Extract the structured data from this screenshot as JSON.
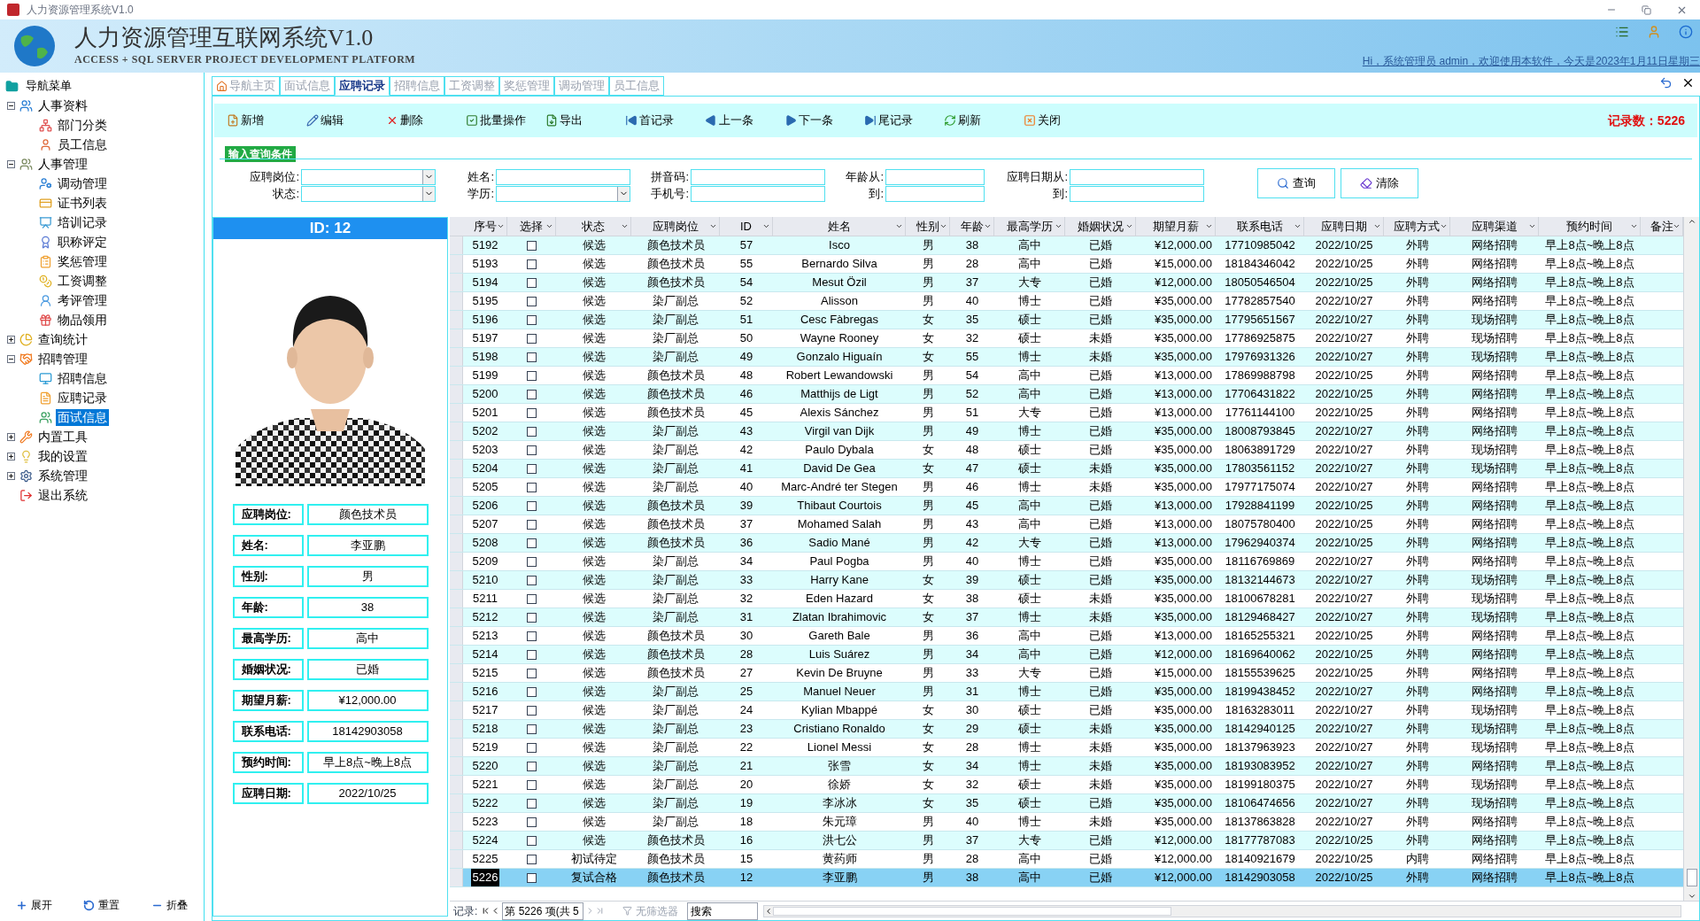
{
  "window": {
    "title": "人力资源管理系统V1.0"
  },
  "header": {
    "title": "人力资源管理互联网系统V1.0",
    "subtitle": "ACCESS + SQL SERVER PROJECT DEVELOPMENT PLATFORM",
    "welcome": "Hi，系统管理员 admin，欢迎使用本软件，今天是2023年1月11日星期三"
  },
  "sidebar": {
    "title": "导航菜单",
    "items": [
      {
        "label": "人事资料",
        "expanded": true,
        "selected": false,
        "children": [
          {
            "label": "部门分类",
            "selected": false
          },
          {
            "label": "员工信息",
            "selected": false
          }
        ]
      },
      {
        "label": "人事管理",
        "expanded": true,
        "selected": false,
        "children": [
          {
            "label": "调动管理",
            "selected": false
          },
          {
            "label": "证书列表",
            "selected": false
          },
          {
            "label": "培训记录",
            "selected": false
          },
          {
            "label": "职称评定",
            "selected": false
          },
          {
            "label": "奖惩管理",
            "selected": false
          },
          {
            "label": "工资调整",
            "selected": false
          },
          {
            "label": "考评管理",
            "selected": false
          },
          {
            "label": "物品领用",
            "selected": false
          }
        ]
      },
      {
        "label": "查询统计",
        "expanded": false,
        "selected": false
      },
      {
        "label": "招聘管理",
        "expanded": true,
        "selected": false,
        "children": [
          {
            "label": "招聘信息",
            "selected": false
          },
          {
            "label": "应聘记录",
            "selected": false
          },
          {
            "label": "面试信息",
            "selected": true
          }
        ]
      },
      {
        "label": "内置工具",
        "expanded": false,
        "selected": false
      },
      {
        "label": "我的设置",
        "expanded": false,
        "selected": false
      },
      {
        "label": "系统管理",
        "expanded": false,
        "selected": false
      },
      {
        "label": "退出系统",
        "selected": false
      }
    ],
    "footer": [
      "展开",
      "重置",
      "折叠"
    ]
  },
  "tabs": [
    {
      "label": "导航主页",
      "selected": false
    },
    {
      "label": "面试信息",
      "selected": false
    },
    {
      "label": "应聘记录",
      "selected": true
    },
    {
      "label": "招聘信息",
      "selected": false
    },
    {
      "label": "工资调整",
      "selected": false
    },
    {
      "label": "奖惩管理",
      "selected": false
    },
    {
      "label": "调动管理",
      "selected": false
    },
    {
      "label": "员工信息",
      "selected": false
    }
  ],
  "toolbar": {
    "buttons": [
      "新增",
      "编辑",
      "删除",
      "批量操作",
      "导出",
      "首记录",
      "上一条",
      "下一条",
      "尾记录",
      "刷新",
      "关闭"
    ],
    "record_count": "记录数：5226"
  },
  "query": {
    "title": "输入查询条件",
    "groups": [
      [
        {
          "label": "应聘岗位:",
          "kind": "select"
        },
        {
          "label": "状态:",
          "kind": "select"
        }
      ],
      [
        {
          "label": "姓名:",
          "kind": "text"
        },
        {
          "label": "学历:",
          "kind": "select"
        }
      ],
      [
        {
          "label": "拼音码:",
          "kind": "text"
        },
        {
          "label": "手机号:",
          "kind": "text"
        }
      ],
      [
        {
          "label": "年龄从:",
          "kind": "text"
        },
        {
          "label": "到:",
          "kind": "text"
        }
      ],
      [
        {
          "label": "应聘日期从:",
          "kind": "text"
        },
        {
          "label": "到:",
          "kind": "text"
        }
      ]
    ],
    "buttons": [
      "查询",
      "清除"
    ]
  },
  "profile": {
    "heading": "ID: 12",
    "fields": [
      {
        "label": "应聘岗位:",
        "value": "颜色技术员"
      },
      {
        "label": "姓名:",
        "value": "李亚鹏"
      },
      {
        "label": "性别:",
        "value": "男"
      },
      {
        "label": "年龄:",
        "value": "38"
      },
      {
        "label": "最高学历:",
        "value": "高中"
      },
      {
        "label": "婚姻状况:",
        "value": "已婚"
      },
      {
        "label": "期望月薪:",
        "value": "¥12,000.00"
      },
      {
        "label": "联系电话:",
        "value": "18142903058"
      },
      {
        "label": "预约时间:",
        "value": "早上8点~晚上8点"
      },
      {
        "label": "应聘日期:",
        "value": "2022/10/25"
      }
    ]
  },
  "table": {
    "columns": [
      "序号",
      "选择",
      "状态",
      "应聘岗位",
      "ID",
      "姓名",
      "性别",
      "年龄",
      "最高学历",
      "婚姻状况",
      "期望月薪",
      "联系电话",
      "应聘日期",
      "应聘方式",
      "应聘渠道",
      "预约时间",
      "备注"
    ],
    "rows": [
      {
        "no": "5192",
        "checked": false,
        "status": "候选",
        "position": "颜色技术员",
        "id": "57",
        "name": "Isco",
        "gender": "男",
        "age": "38",
        "education": "高中",
        "marital": "已婚",
        "salary": "¥12,000.00",
        "phone": "17710985042",
        "date": "2022/10/25",
        "method": "外聘",
        "channel": "网络招聘",
        "time": "早上8点~晚上8点",
        "selected": false
      },
      {
        "no": "5193",
        "checked": false,
        "status": "候选",
        "position": "颜色技术员",
        "id": "55",
        "name": "Bernardo Silva",
        "gender": "男",
        "age": "28",
        "education": "高中",
        "marital": "已婚",
        "salary": "¥15,000.00",
        "phone": "18184346042",
        "date": "2022/10/25",
        "method": "外聘",
        "channel": "网络招聘",
        "time": "早上8点~晚上8点",
        "selected": false
      },
      {
        "no": "5194",
        "checked": false,
        "status": "候选",
        "position": "颜色技术员",
        "id": "54",
        "name": "Mesut Özil",
        "gender": "男",
        "age": "37",
        "education": "大专",
        "marital": "已婚",
        "salary": "¥12,000.00",
        "phone": "18050546504",
        "date": "2022/10/25",
        "method": "外聘",
        "channel": "网络招聘",
        "time": "早上8点~晚上8点",
        "selected": false
      },
      {
        "no": "5195",
        "checked": false,
        "status": "候选",
        "position": "染厂副总",
        "id": "52",
        "name": "Alisson",
        "gender": "男",
        "age": "40",
        "education": "博士",
        "marital": "已婚",
        "salary": "¥35,000.00",
        "phone": "17782857540",
        "date": "2022/10/27",
        "method": "外聘",
        "channel": "网络招聘",
        "time": "早上8点~晚上8点",
        "selected": false
      },
      {
        "no": "5196",
        "checked": false,
        "status": "候选",
        "position": "染厂副总",
        "id": "51",
        "name": "Cesc Fàbregas",
        "gender": "女",
        "age": "35",
        "education": "硕士",
        "marital": "已婚",
        "salary": "¥35,000.00",
        "phone": "17795651567",
        "date": "2022/10/27",
        "method": "外聘",
        "channel": "现场招聘",
        "time": "早上8点~晚上8点",
        "selected": false
      },
      {
        "no": "5197",
        "checked": false,
        "status": "候选",
        "position": "染厂副总",
        "id": "50",
        "name": "Wayne Rooney",
        "gender": "女",
        "age": "32",
        "education": "硕士",
        "marital": "未婚",
        "salary": "¥35,000.00",
        "phone": "17786925875",
        "date": "2022/10/27",
        "method": "外聘",
        "channel": "现场招聘",
        "time": "早上8点~晚上8点",
        "selected": false
      },
      {
        "no": "5198",
        "checked": false,
        "status": "候选",
        "position": "染厂副总",
        "id": "49",
        "name": "Gonzalo Higuaín",
        "gender": "女",
        "age": "55",
        "education": "博士",
        "marital": "未婚",
        "salary": "¥35,000.00",
        "phone": "17976931326",
        "date": "2022/10/27",
        "method": "外聘",
        "channel": "现场招聘",
        "time": "早上8点~晚上8点",
        "selected": false
      },
      {
        "no": "5199",
        "checked": false,
        "status": "候选",
        "position": "颜色技术员",
        "id": "48",
        "name": "Robert Lewandowski",
        "gender": "男",
        "age": "54",
        "education": "高中",
        "marital": "已婚",
        "salary": "¥13,000.00",
        "phone": "17869988798",
        "date": "2022/10/25",
        "method": "外聘",
        "channel": "网络招聘",
        "time": "早上8点~晚上8点",
        "selected": false
      },
      {
        "no": "5200",
        "checked": false,
        "status": "候选",
        "position": "颜色技术员",
        "id": "46",
        "name": "Matthijs de Ligt",
        "gender": "男",
        "age": "52",
        "education": "高中",
        "marital": "已婚",
        "salary": "¥13,000.00",
        "phone": "17706431822",
        "date": "2022/10/25",
        "method": "外聘",
        "channel": "网络招聘",
        "time": "早上8点~晚上8点",
        "selected": false
      },
      {
        "no": "5201",
        "checked": false,
        "status": "候选",
        "position": "颜色技术员",
        "id": "45",
        "name": "Alexis Sánchez",
        "gender": "男",
        "age": "51",
        "education": "大专",
        "marital": "已婚",
        "salary": "¥13,000.00",
        "phone": "17761144100",
        "date": "2022/10/25",
        "method": "外聘",
        "channel": "网络招聘",
        "time": "早上8点~晚上8点",
        "selected": false
      },
      {
        "no": "5202",
        "checked": false,
        "status": "候选",
        "position": "染厂副总",
        "id": "43",
        "name": "Virgil van Dijk",
        "gender": "男",
        "age": "49",
        "education": "博士",
        "marital": "已婚",
        "salary": "¥35,000.00",
        "phone": "18008793845",
        "date": "2022/10/27",
        "method": "外聘",
        "channel": "网络招聘",
        "time": "早上8点~晚上8点",
        "selected": false
      },
      {
        "no": "5203",
        "checked": false,
        "status": "候选",
        "position": "染厂副总",
        "id": "42",
        "name": "Paulo Dybala",
        "gender": "女",
        "age": "48",
        "education": "硕士",
        "marital": "已婚",
        "salary": "¥35,000.00",
        "phone": "18063891729",
        "date": "2022/10/27",
        "method": "外聘",
        "channel": "现场招聘",
        "time": "早上8点~晚上8点",
        "selected": false
      },
      {
        "no": "5204",
        "checked": false,
        "status": "候选",
        "position": "染厂副总",
        "id": "41",
        "name": "David De Gea",
        "gender": "女",
        "age": "47",
        "education": "硕士",
        "marital": "未婚",
        "salary": "¥35,000.00",
        "phone": "17803561152",
        "date": "2022/10/27",
        "method": "外聘",
        "channel": "现场招聘",
        "time": "早上8点~晚上8点",
        "selected": false
      },
      {
        "no": "5205",
        "checked": false,
        "status": "候选",
        "position": "染厂副总",
        "id": "40",
        "name": "Marc-André ter Stegen",
        "gender": "男",
        "age": "46",
        "education": "博士",
        "marital": "未婚",
        "salary": "¥35,000.00",
        "phone": "17977175074",
        "date": "2022/10/27",
        "method": "外聘",
        "channel": "网络招聘",
        "time": "早上8点~晚上8点",
        "selected": false
      },
      {
        "no": "5206",
        "checked": false,
        "status": "候选",
        "position": "颜色技术员",
        "id": "39",
        "name": "Thibaut Courtois",
        "gender": "男",
        "age": "45",
        "education": "高中",
        "marital": "已婚",
        "salary": "¥13,000.00",
        "phone": "17928841199",
        "date": "2022/10/25",
        "method": "外聘",
        "channel": "网络招聘",
        "time": "早上8点~晚上8点",
        "selected": false
      },
      {
        "no": "5207",
        "checked": false,
        "status": "候选",
        "position": "颜色技术员",
        "id": "37",
        "name": "Mohamed Salah",
        "gender": "男",
        "age": "43",
        "education": "高中",
        "marital": "已婚",
        "salary": "¥13,000.00",
        "phone": "18075780400",
        "date": "2022/10/25",
        "method": "外聘",
        "channel": "网络招聘",
        "time": "早上8点~晚上8点",
        "selected": false
      },
      {
        "no": "5208",
        "checked": false,
        "status": "候选",
        "position": "颜色技术员",
        "id": "36",
        "name": "Sadio Mané",
        "gender": "男",
        "age": "42",
        "education": "大专",
        "marital": "已婚",
        "salary": "¥13,000.00",
        "phone": "17962940374",
        "date": "2022/10/25",
        "method": "外聘",
        "channel": "网络招聘",
        "time": "早上8点~晚上8点",
        "selected": false
      },
      {
        "no": "5209",
        "checked": false,
        "status": "候选",
        "position": "染厂副总",
        "id": "34",
        "name": "Paul Pogba",
        "gender": "男",
        "age": "40",
        "education": "博士",
        "marital": "已婚",
        "salary": "¥35,000.00",
        "phone": "18116769869",
        "date": "2022/10/27",
        "method": "外聘",
        "channel": "网络招聘",
        "time": "早上8点~晚上8点",
        "selected": false
      },
      {
        "no": "5210",
        "checked": false,
        "status": "候选",
        "position": "染厂副总",
        "id": "33",
        "name": "Harry Kane",
        "gender": "女",
        "age": "39",
        "education": "硕士",
        "marital": "已婚",
        "salary": "¥35,000.00",
        "phone": "18132144673",
        "date": "2022/10/27",
        "method": "外聘",
        "channel": "现场招聘",
        "time": "早上8点~晚上8点",
        "selected": false
      },
      {
        "no": "5211",
        "checked": false,
        "status": "候选",
        "position": "染厂副总",
        "id": "32",
        "name": "Eden Hazard",
        "gender": "女",
        "age": "38",
        "education": "硕士",
        "marital": "未婚",
        "salary": "¥35,000.00",
        "phone": "18100678281",
        "date": "2022/10/27",
        "method": "外聘",
        "channel": "现场招聘",
        "time": "早上8点~晚上8点",
        "selected": false
      },
      {
        "no": "5212",
        "checked": false,
        "status": "候选",
        "position": "染厂副总",
        "id": "31",
        "name": "Zlatan Ibrahimovic",
        "gender": "女",
        "age": "37",
        "education": "博士",
        "marital": "未婚",
        "salary": "¥35,000.00",
        "phone": "18129468427",
        "date": "2022/10/27",
        "method": "外聘",
        "channel": "现场招聘",
        "time": "早上8点~晚上8点",
        "selected": false
      },
      {
        "no": "5213",
        "checked": false,
        "status": "候选",
        "position": "颜色技术员",
        "id": "30",
        "name": "Gareth Bale",
        "gender": "男",
        "age": "36",
        "education": "高中",
        "marital": "已婚",
        "salary": "¥13,000.00",
        "phone": "18165255321",
        "date": "2022/10/25",
        "method": "外聘",
        "channel": "网络招聘",
        "time": "早上8点~晚上8点",
        "selected": false
      },
      {
        "no": "5214",
        "checked": false,
        "status": "候选",
        "position": "颜色技术员",
        "id": "28",
        "name": "Luis Suárez",
        "gender": "男",
        "age": "34",
        "education": "高中",
        "marital": "已婚",
        "salary": "¥12,000.00",
        "phone": "18169640062",
        "date": "2022/10/25",
        "method": "外聘",
        "channel": "网络招聘",
        "time": "早上8点~晚上8点",
        "selected": false
      },
      {
        "no": "5215",
        "checked": false,
        "status": "候选",
        "position": "颜色技术员",
        "id": "27",
        "name": "Kevin De Bruyne",
        "gender": "男",
        "age": "33",
        "education": "大专",
        "marital": "已婚",
        "salary": "¥15,000.00",
        "phone": "18155539625",
        "date": "2022/10/25",
        "method": "外聘",
        "channel": "网络招聘",
        "time": "早上8点~晚上8点",
        "selected": false
      },
      {
        "no": "5216",
        "checked": false,
        "status": "候选",
        "position": "染厂副总",
        "id": "25",
        "name": "Manuel Neuer",
        "gender": "男",
        "age": "31",
        "education": "博士",
        "marital": "已婚",
        "salary": "¥35,000.00",
        "phone": "18199438452",
        "date": "2022/10/27",
        "method": "外聘",
        "channel": "网络招聘",
        "time": "早上8点~晚上8点",
        "selected": false
      },
      {
        "no": "5217",
        "checked": false,
        "status": "候选",
        "position": "染厂副总",
        "id": "24",
        "name": "Kylian Mbappé",
        "gender": "女",
        "age": "30",
        "education": "硕士",
        "marital": "已婚",
        "salary": "¥35,000.00",
        "phone": "18163283011",
        "date": "2022/10/27",
        "method": "外聘",
        "channel": "现场招聘",
        "time": "早上8点~晚上8点",
        "selected": false
      },
      {
        "no": "5218",
        "checked": false,
        "status": "候选",
        "position": "染厂副总",
        "id": "23",
        "name": "Cristiano Ronaldo",
        "gender": "女",
        "age": "29",
        "education": "硕士",
        "marital": "未婚",
        "salary": "¥35,000.00",
        "phone": "18142940125",
        "date": "2022/10/27",
        "method": "外聘",
        "channel": "现场招聘",
        "time": "早上8点~晚上8点",
        "selected": false
      },
      {
        "no": "5219",
        "checked": false,
        "status": "候选",
        "position": "染厂副总",
        "id": "22",
        "name": "Lionel Messi",
        "gender": "女",
        "age": "28",
        "education": "博士",
        "marital": "未婚",
        "salary": "¥35,000.00",
        "phone": "18137963923",
        "date": "2022/10/27",
        "method": "外聘",
        "channel": "现场招聘",
        "time": "早上8点~晚上8点",
        "selected": false
      },
      {
        "no": "5220",
        "checked": false,
        "status": "候选",
        "position": "染厂副总",
        "id": "21",
        "name": "张雪",
        "gender": "女",
        "age": "34",
        "education": "博士",
        "marital": "未婚",
        "salary": "¥35,000.00",
        "phone": "18193083952",
        "date": "2022/10/27",
        "method": "外聘",
        "channel": "网络招聘",
        "time": "早上8点~晚上8点",
        "selected": false
      },
      {
        "no": "5221",
        "checked": false,
        "status": "候选",
        "position": "染厂副总",
        "id": "20",
        "name": "徐娇",
        "gender": "女",
        "age": "32",
        "education": "硕士",
        "marital": "未婚",
        "salary": "¥35,000.00",
        "phone": "18199180375",
        "date": "2022/10/27",
        "method": "外聘",
        "channel": "现场招聘",
        "time": "早上8点~晚上8点",
        "selected": false
      },
      {
        "no": "5222",
        "checked": false,
        "status": "候选",
        "position": "染厂副总",
        "id": "19",
        "name": "李冰冰",
        "gender": "女",
        "age": "35",
        "education": "硕士",
        "marital": "已婚",
        "salary": "¥35,000.00",
        "phone": "18106474656",
        "date": "2022/10/27",
        "method": "外聘",
        "channel": "现场招聘",
        "time": "早上8点~晚上8点",
        "selected": false
      },
      {
        "no": "5223",
        "checked": false,
        "status": "候选",
        "position": "染厂副总",
        "id": "18",
        "name": "朱元璋",
        "gender": "男",
        "age": "40",
        "education": "博士",
        "marital": "未婚",
        "salary": "¥35,000.00",
        "phone": "18137863828",
        "date": "2022/10/27",
        "method": "外聘",
        "channel": "网络招聘",
        "time": "早上8点~晚上8点",
        "selected": false
      },
      {
        "no": "5224",
        "checked": false,
        "status": "候选",
        "position": "颜色技术员",
        "id": "16",
        "name": "洪七公",
        "gender": "男",
        "age": "37",
        "education": "大专",
        "marital": "已婚",
        "salary": "¥12,000.00",
        "phone": "18177787083",
        "date": "2022/10/25",
        "method": "外聘",
        "channel": "网络招聘",
        "time": "早上8点~晚上8点",
        "selected": false
      },
      {
        "no": "5225",
        "checked": false,
        "status": "初试待定",
        "position": "颜色技术员",
        "id": "15",
        "name": "黄药师",
        "gender": "男",
        "age": "28",
        "education": "高中",
        "marital": "已婚",
        "salary": "¥12,000.00",
        "phone": "18140921679",
        "date": "2022/10/25",
        "method": "内聘",
        "channel": "网络招聘",
        "time": "早上8点~晚上8点",
        "selected": false
      },
      {
        "no": "5226",
        "checked": false,
        "status": "复试合格",
        "position": "颜色技术员",
        "id": "12",
        "name": "李亚鹏",
        "gender": "男",
        "age": "38",
        "education": "高中",
        "marital": "已婚",
        "salary": "¥12,000.00",
        "phone": "18142903058",
        "date": "2022/10/25",
        "method": "外聘",
        "channel": "网络招聘",
        "time": "早上8点~晚上8点",
        "selected": true
      }
    ]
  },
  "navigator": {
    "label": "记录:",
    "position": "第 5226 项(共 5",
    "filter": "无筛选器",
    "search": "搜索"
  }
}
